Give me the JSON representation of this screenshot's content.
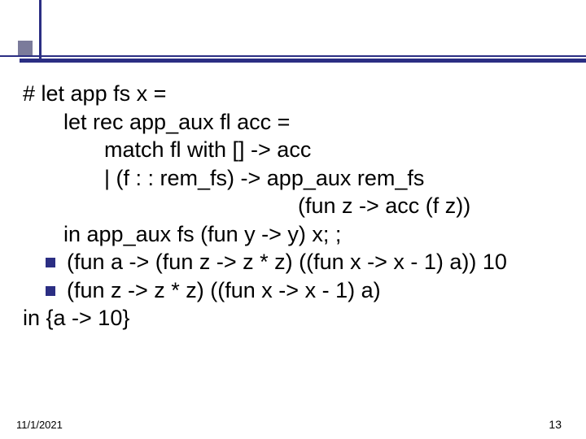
{
  "code": {
    "l1": "# let app fs x =",
    "l2": "let rec app_aux fl acc =",
    "l3": "match fl with [] -> acc",
    "l4": "| (f : : rem_fs) -> app_aux rem_fs",
    "l5": "(fun z -> acc (f z))",
    "l6": "in app_aux fs (fun y -> y) x; ;",
    "b1": "(fun a -> (fun z -> z * z) ((fun x -> x - 1) a)) 10",
    "b2": "(fun z -> z * z) ((fun x -> x - 1) a)",
    "l9": "in {a -> 10}"
  },
  "footer": {
    "date": "11/1/2021",
    "page": "13"
  }
}
